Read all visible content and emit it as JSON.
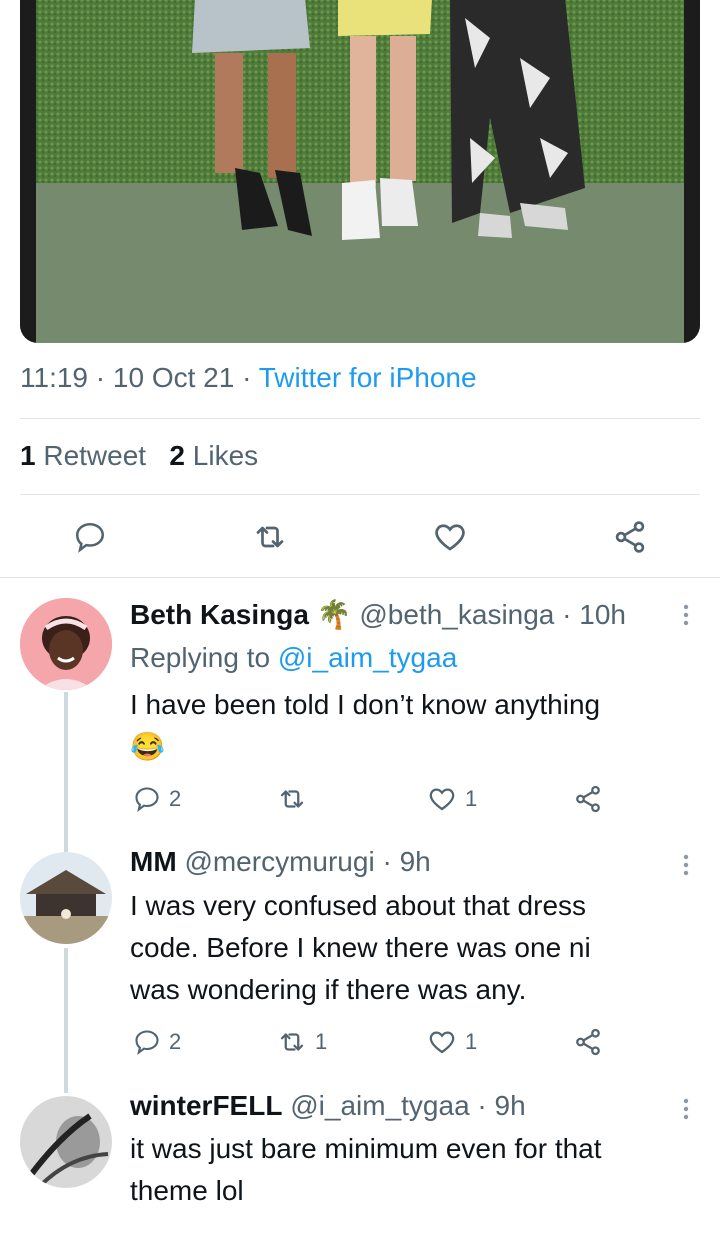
{
  "tweet": {
    "time": "11:19",
    "date": "10 Oct 21",
    "source": "Twitter for iPhone",
    "retweet_count": "1",
    "retweet_label": "Retweet",
    "like_count": "2",
    "like_label": "Likes"
  },
  "replies": [
    {
      "name": "Beth Kasinga",
      "emoji": "🌴",
      "handle": "@beth_kasinga",
      "time": "10h",
      "replying_label": "Replying to",
      "replying_handle": "@i_aim_tygaa",
      "text_line1": "I have been told I don’t know anything",
      "text_line2": "😂",
      "replies": "2",
      "retweets": "",
      "likes": "1"
    },
    {
      "name": "MM",
      "handle": "@mercymurugi",
      "time": "9h",
      "text_line1": "I was very confused about that dress",
      "text_line2": "code. Before I knew there was one ni",
      "text_line3": "was wondering if there was any.",
      "replies": "2",
      "retweets": "1",
      "likes": "1"
    },
    {
      "name": "winterFELL",
      "handle": "@i_aim_tygaa",
      "time": "9h",
      "text_line1": "it was just bare minimum even for that",
      "text_line2": "theme lol"
    }
  ],
  "colors": {
    "accent": "#1d9bf0",
    "muted": "#536471",
    "text": "#0f1419"
  }
}
